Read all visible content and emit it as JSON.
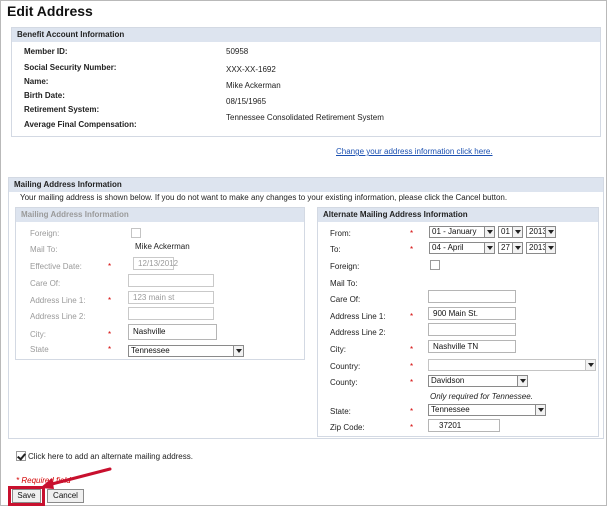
{
  "page_title": "Edit Address",
  "benefit": {
    "header": "Benefit Account Information",
    "rows": [
      {
        "label": "Member ID:",
        "value": "50958"
      },
      {
        "label": "Social Security Number:",
        "value": "XXX-XX-1692"
      },
      {
        "label": "Name:",
        "value": "Mike Ackerman"
      },
      {
        "label": "Birth Date:",
        "value": "08/15/1965"
      },
      {
        "label": "Retirement System:",
        "value": "Tennessee Consolidated Retirement System"
      },
      {
        "label": "Average Final Compensation:",
        "value": ""
      }
    ],
    "change_link": "Change your address information click here."
  },
  "mailing": {
    "header": "Mailing Address Information",
    "instruction": "Your mailing address is shown below. If you do not want to make any changes to your existing information, please click the Cancel button.",
    "current": {
      "header": "Mailing Address Information",
      "foreign_label": "Foreign:",
      "mail_to_label": "Mail To:",
      "mail_to_value": "Mike Ackerman",
      "effective_date_label": "Effective Date:",
      "effective_date_value": "12/13/2012",
      "care_of_label": "Care Of:",
      "care_of_value": "",
      "address1_label": "Address Line 1:",
      "address1_value": "123 main st",
      "address2_label": "Address Line 2:",
      "address2_value": "",
      "city_label": "City:",
      "city_value": "Nashville",
      "state_label": "State",
      "state_value": "Tennessee"
    },
    "alternate": {
      "header": "Alternate Mailing Address Information",
      "from_label": "From:",
      "from_month": "01 - January",
      "from_day": "01",
      "from_year": "2013",
      "to_label": "To:",
      "to_month": "04 - April",
      "to_day": "27",
      "to_year": "2013",
      "foreign_label": "Foreign:",
      "mail_to_label": "Mail To:",
      "care_of_label": "Care Of:",
      "care_of_value": "",
      "address1_label": "Address Line 1:",
      "address1_value": "900 Main St.",
      "address2_label": "Address Line 2:",
      "address2_value": "",
      "city_label": "City:",
      "city_value": "Nashville TN",
      "country_label": "Country:",
      "country_value": "",
      "county_label": "County:",
      "county_value": "Davidson",
      "county_note": "Only required for Tennessee.",
      "state_label": "State:",
      "state_value": "Tennessee",
      "zip_label": "Zip Code:",
      "zip_value": "37201"
    },
    "alt_checkbox_label": "Click here to add an alternate mailing address."
  },
  "required_note": "* Required field",
  "required_mark": "*",
  "buttons": {
    "save": "Save",
    "cancel": "Cancel"
  },
  "colors": {
    "accent": "#dde4ef",
    "required": "#d40000",
    "highlight": "#c8102e",
    "link": "#1a4fb0"
  }
}
